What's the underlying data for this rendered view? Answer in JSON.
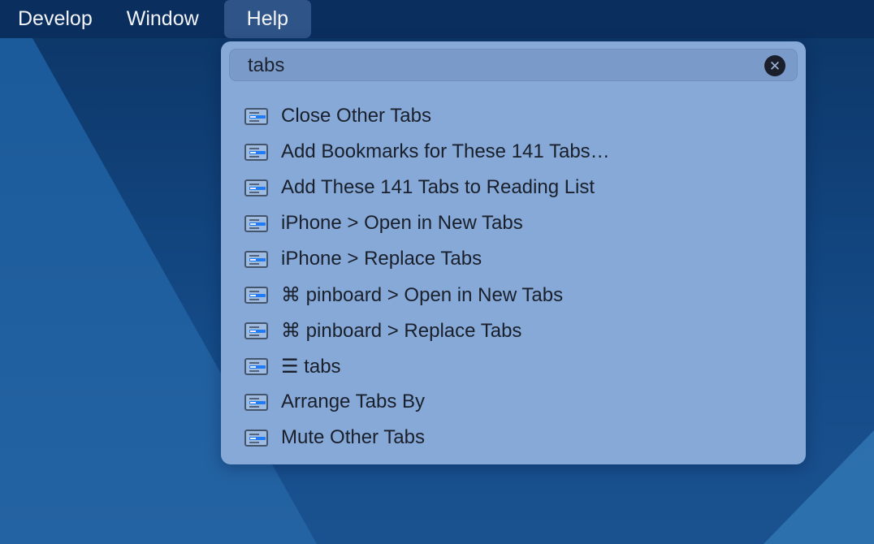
{
  "menubar": {
    "items": [
      {
        "label": "Develop",
        "active": false
      },
      {
        "label": "Window",
        "active": false
      },
      {
        "label": "Help",
        "active": true
      }
    ]
  },
  "help_menu": {
    "search": {
      "value": "tabs",
      "clear_icon": "clear-x-circle-icon",
      "clear_glyph": "✕"
    },
    "results": [
      {
        "label": "Close Other Tabs",
        "icon": "menu-item-icon"
      },
      {
        "label": "Add Bookmarks for These 141 Tabs…",
        "icon": "menu-item-icon"
      },
      {
        "label": "Add These 141 Tabs to Reading List",
        "icon": "menu-item-icon"
      },
      {
        "label": "iPhone > Open in New Tabs",
        "icon": "menu-item-icon"
      },
      {
        "label": "iPhone > Replace Tabs",
        "icon": "menu-item-icon"
      },
      {
        "label": "⌘ pinboard > Open in New Tabs",
        "icon": "menu-item-icon"
      },
      {
        "label": "⌘ pinboard > Replace Tabs",
        "icon": "menu-item-icon"
      },
      {
        "label": "☰ tabs",
        "icon": "menu-item-icon"
      },
      {
        "label": "Arrange Tabs By",
        "icon": "menu-item-icon"
      },
      {
        "label": "Mute Other Tabs",
        "icon": "menu-item-icon"
      }
    ]
  },
  "colors": {
    "menubar": "#0a2e5e",
    "active_menu": "#2f5487",
    "panel": "#86a9d8",
    "accent": "#1f7cf5"
  }
}
